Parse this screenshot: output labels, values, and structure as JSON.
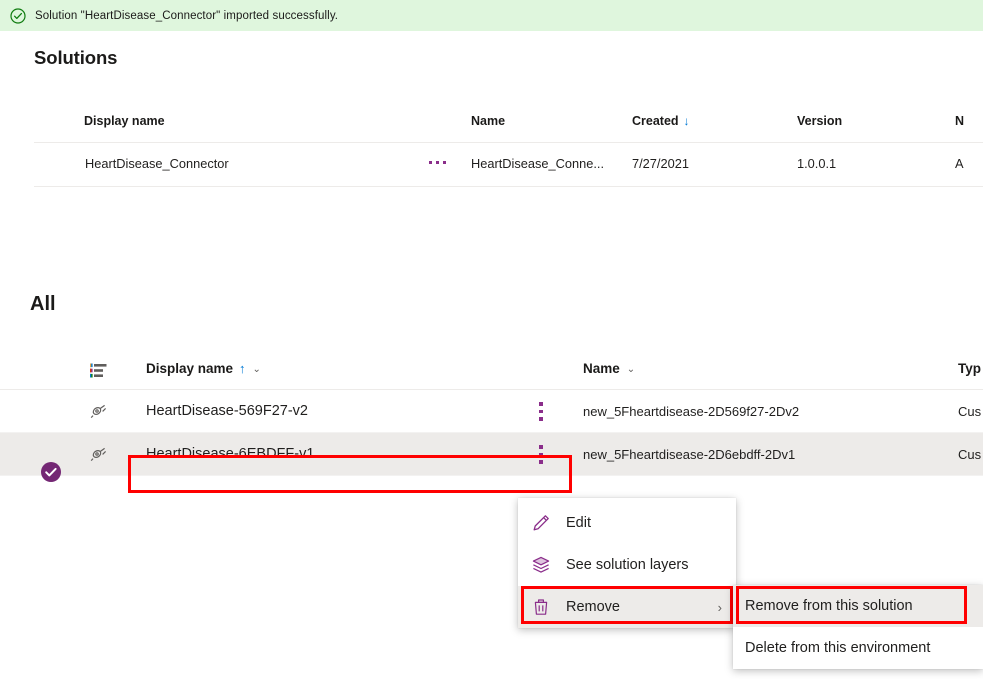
{
  "banner": {
    "icon": "check-circle-icon",
    "message": "Solution \"HeartDisease_Connector\" imported successfully.",
    "background_color": "#dff6dd",
    "icon_color": "#107c10"
  },
  "solutions_section": {
    "title": "Solutions",
    "columns": [
      {
        "label": "Display name",
        "sorted": false
      },
      {
        "label": "Name",
        "sorted": false
      },
      {
        "label": "Created",
        "sorted": true,
        "sort_glyph": "↓"
      },
      {
        "label": "Version",
        "sorted": false
      },
      {
        "label": "N",
        "clipped": true
      }
    ],
    "rows": [
      {
        "display_name": "HeartDisease_Connector",
        "overflow_icon": "ellipsis-horizontal-icon",
        "name": "HeartDisease_Conne...",
        "created": "7/27/2021",
        "version": "1.0.0.1",
        "last_clipped": "A"
      }
    ]
  },
  "all_section": {
    "title": "All",
    "columns": [
      {
        "label": "",
        "icon": "component-type-icon"
      },
      {
        "label": "Display name",
        "sort_glyph": "↑",
        "chevron": "⌄"
      },
      {
        "label": "Name",
        "chevron": "⌄"
      },
      {
        "label": "Typ",
        "clipped": true
      }
    ],
    "rows": [
      {
        "selected": false,
        "type_icon": "connector-plug-icon",
        "display_name": "HeartDisease-569F27-v2",
        "menu_icon": "more-vertical-icon",
        "name": "new_5Fheartdisease-2D569f27-2Dv2",
        "type": "Cus"
      },
      {
        "selected": true,
        "selection_icon": "check-circle-filled-icon",
        "type_icon": "connector-plug-icon",
        "display_name": "HeartDisease-6EBDFF-v1",
        "menu_icon": "more-vertical-icon",
        "name": "new_5Fheartdisease-2D6ebdff-2Dv1",
        "type": "Cus"
      }
    ]
  },
  "context_menu": {
    "items": [
      {
        "label": "Edit",
        "icon": "pencil-icon",
        "highlighted": false,
        "has_submenu": false
      },
      {
        "label": "See solution layers",
        "icon": "layers-icon",
        "highlighted": false,
        "has_submenu": false
      },
      {
        "label": "Remove",
        "icon": "trash-icon",
        "highlighted": true,
        "has_submenu": true,
        "chevron": "›"
      }
    ]
  },
  "submenu": {
    "items": [
      {
        "label": "Remove from this solution",
        "highlighted": true
      },
      {
        "label": "Delete from this environment",
        "highlighted": false
      }
    ]
  },
  "theme": {
    "accent_purple": "#8a2d8a",
    "selection_purple": "#742774",
    "annotation_red": "#ff0000",
    "sort_blue": "#0078d4",
    "row_selected_bg": "#edebe9"
  }
}
